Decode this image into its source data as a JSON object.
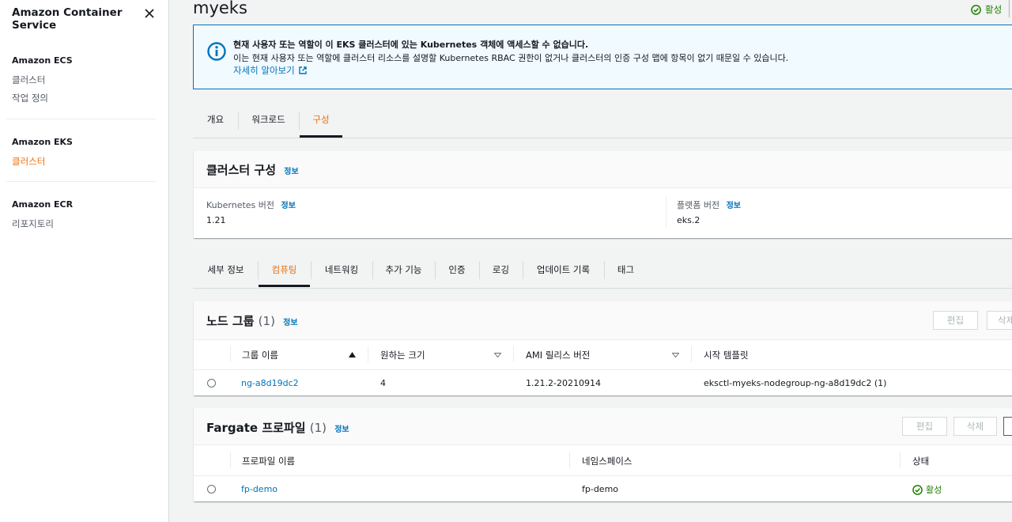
{
  "sidebar": {
    "title": "Amazon Container Service",
    "sections": [
      {
        "heading": "Amazon ECS",
        "items": [
          "클러스터",
          "작업 정의"
        ]
      },
      {
        "heading": "Amazon EKS",
        "items": [
          "클러스터"
        ]
      },
      {
        "heading": "Amazon ECR",
        "items": [
          "리포지토리"
        ]
      }
    ]
  },
  "header": {
    "title": "myeks",
    "status": "활성"
  },
  "alert": {
    "title": "현재 사용자 또는 역할이 이 EKS 클러스터에 있는 Kubernetes 객체에 액세스할 수 없습니다.",
    "body": "이는 현재 사용자 또는 역할에 클러스터 리소스를 설명할 Kubernetes RBAC 권한이 없거나 클러스터의 인증 구성 맵에 항목이 없기 때문일 수 있습니다.",
    "link": "자세히 알아보기"
  },
  "tabs": [
    "개요",
    "워크로드",
    "구성"
  ],
  "cluster_config": {
    "title": "클러스터 구성",
    "info": "정보",
    "k8s_label": "Kubernetes 버전",
    "k8s_value": "1.21",
    "platform_label": "플랫폼 버전",
    "platform_value": "eks.2"
  },
  "subtabs": [
    "세부 정보",
    "컴퓨팅",
    "네트워킹",
    "추가 기능",
    "인증",
    "로깅",
    "업데이트 기록",
    "태그"
  ],
  "node_groups": {
    "title": "노드 그룹",
    "count": "(1)",
    "info": "정보",
    "buttons": {
      "edit": "편집",
      "delete": "삭제"
    },
    "columns": [
      "그룹 이름",
      "원하는 크기",
      "AMI 릴리스 버전",
      "시작 템플릿"
    ],
    "rows": [
      {
        "name": "ng-a8d19dc2",
        "size": "4",
        "ami": "1.21.2-20210914",
        "template": "eksctl-myeks-nodegroup-ng-a8d19dc2 (1)"
      }
    ]
  },
  "fargate": {
    "title": "Fargate 프로파일",
    "count": "(1)",
    "info": "정보",
    "buttons": {
      "edit": "편집",
      "delete": "삭제"
    },
    "columns": [
      "프로파일 이름",
      "네임스페이스",
      "상태"
    ],
    "rows": [
      {
        "name": "fp-demo",
        "namespace": "fp-demo",
        "status": "활성"
      }
    ]
  },
  "colors": {
    "accent": "#ec7211",
    "link": "#0073bb",
    "success": "#1d8102"
  }
}
